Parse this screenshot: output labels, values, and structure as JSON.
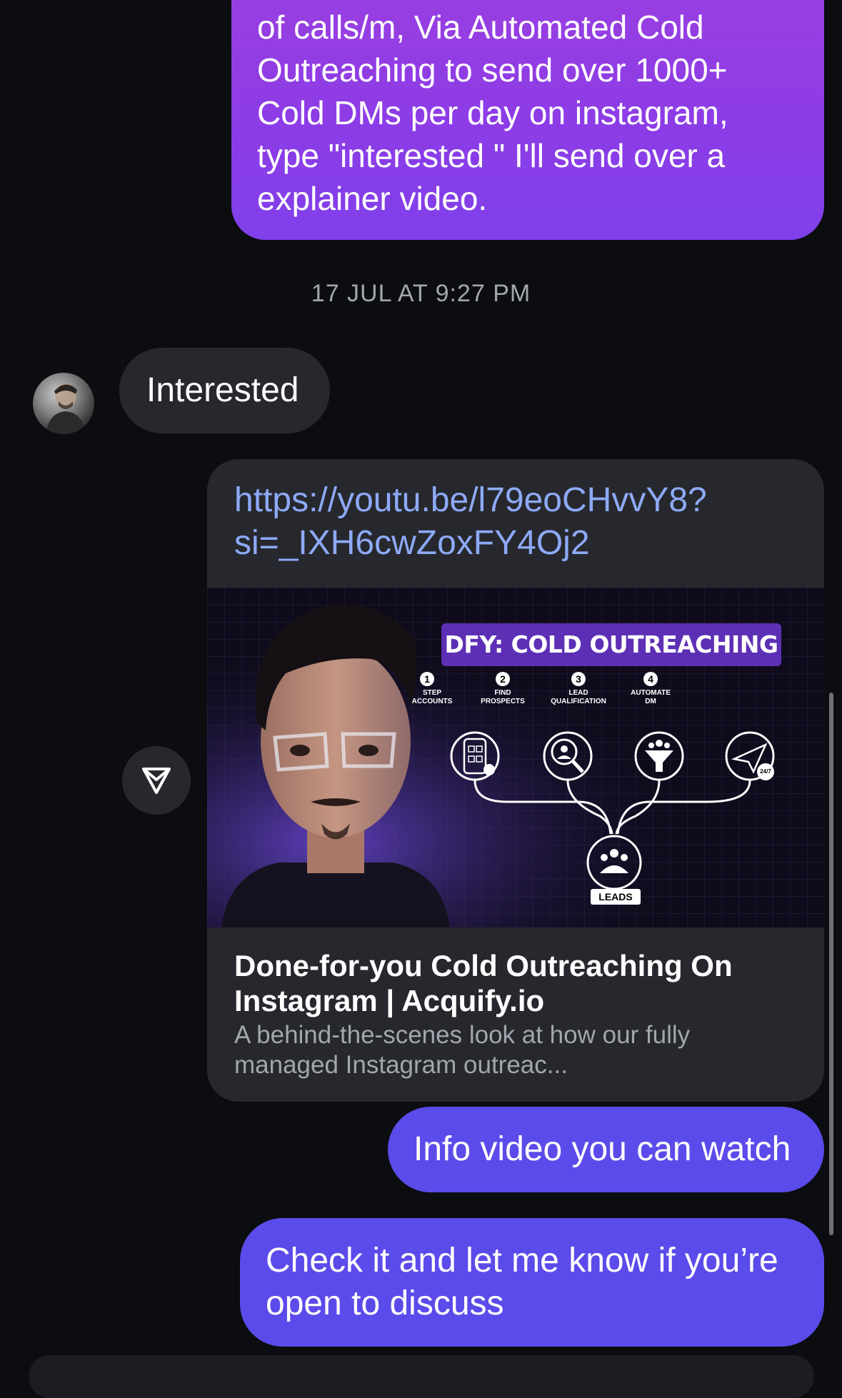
{
  "messages": {
    "outgoing_top": {
      "lines": [
        "of calls/m, Via Automated Cold",
        "Outreaching to send over 1000+",
        "Cold DMs per day on instagram,",
        "type \"interested \" I'll send over a",
        "explainer video."
      ]
    },
    "timestamp": "17 JUL AT 9:27 PM",
    "incoming": {
      "text": "Interested"
    },
    "link_card": {
      "url_lines": [
        "https://youtu.be/l79eoCHvvY8?",
        "si=_IXH6cwZoxFY4Oj2"
      ],
      "title": "Done-for-you Cold Outreaching On Instagram | Acquify.io",
      "description_lines": [
        "A behind-the-scenes look at how our fully",
        "managed Instagram outreac..."
      ],
      "thumbnail": {
        "banner": "DFY: COLD OUTREACHING",
        "steps": [
          {
            "num": "1",
            "label_lines": [
              "STEP",
              "ACCOUNTS"
            ]
          },
          {
            "num": "2",
            "label_lines": [
              "FIND",
              "PROSPECTS"
            ]
          },
          {
            "num": "3",
            "label_lines": [
              "LEAD",
              "QUALIFICATION"
            ]
          },
          {
            "num": "4",
            "label_lines": [
              "AUTOMATE",
              "DM"
            ]
          }
        ],
        "leads_label": "LEADS",
        "badge_247": "24/7"
      }
    },
    "outgoing_1": {
      "text": "Info video you can watch"
    },
    "outgoing_2": {
      "lines": [
        "Check it and let me know if you’re",
        "open to discuss"
      ]
    }
  },
  "icons": {
    "avatar": "user-avatar",
    "share": "send-paper-plane-icon"
  },
  "colors": {
    "background": "#0b0d10",
    "incoming_bubble": "#26282d",
    "outgoing_bubble": "#5b4bea",
    "outgoing_gradient_top": "#9a3fe0",
    "link": "#8eaaf8",
    "muted_text": "#a3a6ad"
  }
}
